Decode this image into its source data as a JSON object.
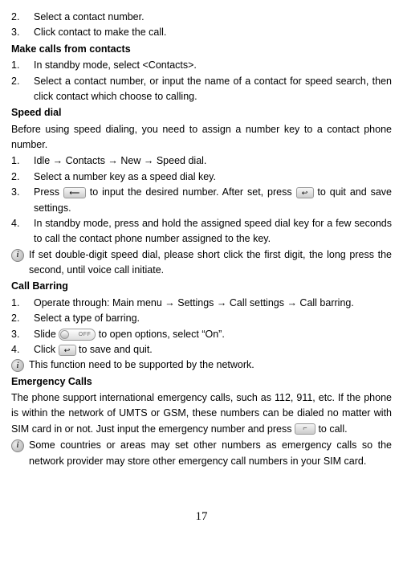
{
  "page_number": "17",
  "arrow": "→",
  "sections": {
    "top_items": [
      {
        "num": "2.",
        "text": "Select a contact number."
      },
      {
        "num": "3.",
        "text": "Click contact to make the call."
      }
    ],
    "make_calls_heading": "Make calls from contacts",
    "make_calls_items": [
      {
        "num": "1.",
        "text": "In standby mode, select <Contacts>."
      },
      {
        "num": "2.",
        "text": "Select a contact number, or input the name of a contact for speed search, then click contact which choose to calling."
      }
    ],
    "speed_dial_heading": "Speed dial",
    "speed_dial_intro": "Before using speed dialing, you need to assign a number key to a contact phone number.",
    "speed_dial_items": [
      {
        "num": "1.",
        "prefix": "Idle ",
        "path1": " Contacts ",
        "path2": " New ",
        "path3": " Speed dial."
      },
      {
        "num": "2.",
        "text": "Select a number key as a speed dial key."
      },
      {
        "num": "3.",
        "pre": "Press ",
        "mid": " to input the desired number. After set, press ",
        "post": " to quit and save settings."
      },
      {
        "num": "4.",
        "text": "In standby mode, press and hold the assigned speed dial key for a few seconds to call the contact phone number assigned to the key."
      }
    ],
    "speed_dial_note": "If set double-digit speed dial, please short click the first digit, the long press the second, until voice call initiate.",
    "call_barring_heading": "Call Barring",
    "call_barring_items": [
      {
        "num": "1.",
        "prefix": "Operate through: Main menu ",
        "path1": " Settings ",
        "path2": " Call settings ",
        "path3": " Call barring."
      },
      {
        "num": "2.",
        "text": "Select a type of barring."
      },
      {
        "num": "3.",
        "pre": "Slide ",
        "post": " to open options, select “On”."
      },
      {
        "num": "4.",
        "pre": "Click ",
        "post": " to save and quit."
      }
    ],
    "call_barring_note": "This function need to be supported by the network.",
    "emergency_heading": "Emergency Calls",
    "emergency_body_pre": "The phone support international emergency calls, such as 112, 911, etc. If the phone is within the network of UMTS or GSM, these numbers can be dialed no matter with SIM card in or not. Just input the emergency number and press ",
    "emergency_body_post": " to call.",
    "emergency_note": "Some countries or areas may set other numbers as emergency calls so the network provider may store other emergency call numbers in your SIM card."
  }
}
